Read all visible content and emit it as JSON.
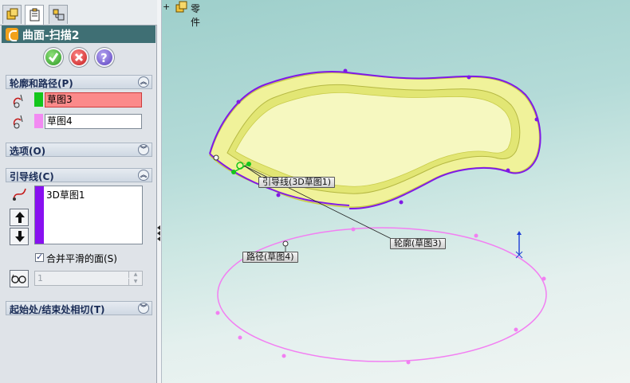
{
  "panel": {
    "title": "曲面-扫描2",
    "sections": {
      "profile_path": {
        "header": "轮廓和路径(P)",
        "profile_value": "草图3",
        "path_value": "草图4",
        "profile_color": "#13c61c",
        "path_color": "#f28af2"
      },
      "options": {
        "header": "选项(O)"
      },
      "guide": {
        "header": "引导线(C)",
        "items": [
          "3D草图1"
        ],
        "merge_label": "合并平滑的面(S)",
        "merge_checked": true,
        "count_value": "1"
      },
      "tangency": {
        "header": "起始处/结束处相切(T)"
      }
    },
    "buttons": {
      "ok": "ok-icon",
      "cancel": "cancel-icon",
      "help": "help-icon"
    }
  },
  "viewport": {
    "tree_label": "零件",
    "callouts": {
      "guide": "引导线(3D草图1)",
      "profile": "轮廓(草图3)",
      "path": "路径(草图4)"
    }
  },
  "colors": {
    "title_bar": "#3f6f74",
    "surface_fill": "#eef196",
    "guide_curve": "#8019e6",
    "path_curve": "#f27ff2"
  }
}
